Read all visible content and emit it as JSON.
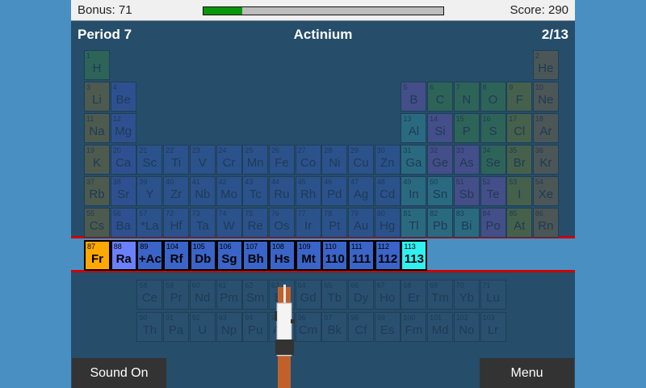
{
  "topbar": {
    "bonus_label": "Bonus: 71",
    "bonus_progress": 0.16,
    "score_label": "Score: 290"
  },
  "header": {
    "period": "Period 7",
    "element_name": "Actinium",
    "question_count": "2/13"
  },
  "category_colors": {
    "nonmetal": "#2e6458",
    "alkali": "#4d5a4e",
    "alkaline": "#2f5090",
    "transition": "#2c528c",
    "post": "#2a6a80",
    "metalloid": "#444e88",
    "halogen": "#45614c",
    "noble": "#4b5656",
    "lanthanide": "#2a5070"
  },
  "active_colors": {
    "current": "#ffa800",
    "answered": "#6a80ff",
    "pending": "#3a64c8",
    "target": "#30f0f0"
  },
  "elements": [
    [
      1,
      "H",
      1,
      1,
      "nonmetal"
    ],
    [
      2,
      "He",
      1,
      18,
      "noble"
    ],
    [
      3,
      "Li",
      2,
      1,
      "alkali"
    ],
    [
      4,
      "Be",
      2,
      2,
      "alkaline"
    ],
    [
      5,
      "B",
      2,
      13,
      "metalloid"
    ],
    [
      6,
      "C",
      2,
      14,
      "nonmetal"
    ],
    [
      7,
      "N",
      2,
      15,
      "nonmetal"
    ],
    [
      8,
      "O",
      2,
      16,
      "nonmetal"
    ],
    [
      9,
      "F",
      2,
      17,
      "halogen"
    ],
    [
      10,
      "Ne",
      2,
      18,
      "noble"
    ],
    [
      11,
      "Na",
      3,
      1,
      "alkali"
    ],
    [
      12,
      "Mg",
      3,
      2,
      "alkaline"
    ],
    [
      13,
      "Al",
      3,
      13,
      "post"
    ],
    [
      14,
      "Si",
      3,
      14,
      "metalloid"
    ],
    [
      15,
      "P",
      3,
      15,
      "nonmetal"
    ],
    [
      16,
      "S",
      3,
      16,
      "nonmetal"
    ],
    [
      17,
      "Cl",
      3,
      17,
      "halogen"
    ],
    [
      18,
      "Ar",
      3,
      18,
      "noble"
    ],
    [
      19,
      "K",
      4,
      1,
      "alkali"
    ],
    [
      20,
      "Ca",
      4,
      2,
      "alkaline"
    ],
    [
      21,
      "Sc",
      4,
      3,
      "transition"
    ],
    [
      22,
      "Ti",
      4,
      4,
      "transition"
    ],
    [
      23,
      "V",
      4,
      5,
      "transition"
    ],
    [
      24,
      "Cr",
      4,
      6,
      "transition"
    ],
    [
      25,
      "Mn",
      4,
      7,
      "transition"
    ],
    [
      26,
      "Fe",
      4,
      8,
      "transition"
    ],
    [
      27,
      "Co",
      4,
      9,
      "transition"
    ],
    [
      28,
      "Ni",
      4,
      10,
      "transition"
    ],
    [
      29,
      "Cu",
      4,
      11,
      "transition"
    ],
    [
      30,
      "Zn",
      4,
      12,
      "transition"
    ],
    [
      31,
      "Ga",
      4,
      13,
      "post"
    ],
    [
      32,
      "Ge",
      4,
      14,
      "metalloid"
    ],
    [
      33,
      "As",
      4,
      15,
      "metalloid"
    ],
    [
      34,
      "Se",
      4,
      16,
      "nonmetal"
    ],
    [
      35,
      "Br",
      4,
      17,
      "halogen"
    ],
    [
      36,
      "Kr",
      4,
      18,
      "noble"
    ],
    [
      37,
      "Rb",
      5,
      1,
      "alkali"
    ],
    [
      38,
      "Sr",
      5,
      2,
      "alkaline"
    ],
    [
      39,
      "Y",
      5,
      3,
      "transition"
    ],
    [
      40,
      "Zr",
      5,
      4,
      "transition"
    ],
    [
      41,
      "Nb",
      5,
      5,
      "transition"
    ],
    [
      42,
      "Mo",
      5,
      6,
      "transition"
    ],
    [
      43,
      "Tc",
      5,
      7,
      "transition"
    ],
    [
      44,
      "Ru",
      5,
      8,
      "transition"
    ],
    [
      45,
      "Rh",
      5,
      9,
      "transition"
    ],
    [
      46,
      "Pd",
      5,
      10,
      "transition"
    ],
    [
      47,
      "Ag",
      5,
      11,
      "transition"
    ],
    [
      48,
      "Cd",
      5,
      12,
      "transition"
    ],
    [
      49,
      "In",
      5,
      13,
      "post"
    ],
    [
      50,
      "Sn",
      5,
      14,
      "post"
    ],
    [
      51,
      "Sb",
      5,
      15,
      "metalloid"
    ],
    [
      52,
      "Te",
      5,
      16,
      "metalloid"
    ],
    [
      53,
      "I",
      5,
      17,
      "halogen"
    ],
    [
      54,
      "Xe",
      5,
      18,
      "noble"
    ],
    [
      55,
      "Cs",
      6,
      1,
      "alkali"
    ],
    [
      56,
      "Ba",
      6,
      2,
      "alkaline"
    ],
    [
      57,
      "*La",
      6,
      3,
      "transition"
    ],
    [
      72,
      "Hf",
      6,
      4,
      "transition"
    ],
    [
      73,
      "Ta",
      6,
      5,
      "transition"
    ],
    [
      74,
      "W",
      6,
      6,
      "transition"
    ],
    [
      75,
      "Re",
      6,
      7,
      "transition"
    ],
    [
      76,
      "Os",
      6,
      8,
      "transition"
    ],
    [
      77,
      "Ir",
      6,
      9,
      "transition"
    ],
    [
      78,
      "Pt",
      6,
      10,
      "transition"
    ],
    [
      79,
      "Au",
      6,
      11,
      "transition"
    ],
    [
      80,
      "Hg",
      6,
      12,
      "transition"
    ],
    [
      81,
      "Tl",
      6,
      13,
      "post"
    ],
    [
      82,
      "Pb",
      6,
      14,
      "post"
    ],
    [
      83,
      "Bi",
      6,
      15,
      "post"
    ],
    [
      84,
      "Po",
      6,
      16,
      "metalloid"
    ],
    [
      85,
      "At",
      6,
      17,
      "halogen"
    ],
    [
      86,
      "Rn",
      6,
      18,
      "noble"
    ]
  ],
  "period7": [
    [
      87,
      "Fr",
      "current"
    ],
    [
      88,
      "Ra",
      "answered"
    ],
    [
      89,
      "+Ac",
      "pending"
    ],
    [
      104,
      "Rf",
      "pending"
    ],
    [
      105,
      "Db",
      "pending"
    ],
    [
      106,
      "Sg",
      "pending"
    ],
    [
      107,
      "Bh",
      "pending"
    ],
    [
      108,
      "Hs",
      "pending"
    ],
    [
      109,
      "Mt",
      "pending"
    ],
    [
      110,
      "110",
      "pending"
    ],
    [
      111,
      "111",
      "pending"
    ],
    [
      112,
      "112",
      "pending"
    ],
    [
      113,
      "113",
      "target"
    ]
  ],
  "lanthanides": [
    [
      58,
      "Ce"
    ],
    [
      59,
      "Pr"
    ],
    [
      60,
      "Nd"
    ],
    [
      61,
      "Pm"
    ],
    [
      62,
      "Sm"
    ],
    [
      63,
      "Eu"
    ],
    [
      64,
      "Gd"
    ],
    [
      65,
      "Tb"
    ],
    [
      66,
      "Dy"
    ],
    [
      67,
      "Ho"
    ],
    [
      68,
      "Er"
    ],
    [
      69,
      "Tm"
    ],
    [
      70,
      "Yb"
    ],
    [
      71,
      "Lu"
    ]
  ],
  "actinides": [
    [
      90,
      "Th"
    ],
    [
      91,
      "Pa"
    ],
    [
      92,
      "U"
    ],
    [
      93,
      "Np"
    ],
    [
      94,
      "Pu"
    ],
    [
      95,
      "Am"
    ],
    [
      96,
      "Cm"
    ],
    [
      97,
      "Bk"
    ],
    [
      98,
      "Cf"
    ],
    [
      99,
      "Es"
    ],
    [
      100,
      "Fm"
    ],
    [
      101,
      "Md"
    ],
    [
      102,
      "No"
    ],
    [
      103,
      "Lr"
    ]
  ],
  "buttons": {
    "sound": "Sound On",
    "menu": "Menu"
  }
}
